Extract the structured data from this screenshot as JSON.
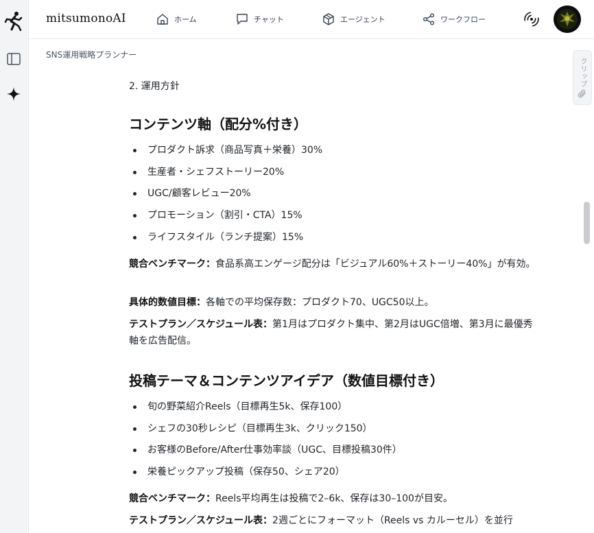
{
  "app": {
    "brand": "mitsumonoAI"
  },
  "nav": {
    "home": "ホーム",
    "chat": "チャット",
    "agent": "エージェント",
    "workflow": "ワークフロー"
  },
  "breadcrumb": "SNS運用戦略プランナー",
  "clip_tab": "クリップ",
  "content": {
    "section_label": "2. 運用方針",
    "section1": {
      "heading": "コンテンツ軸（配分%付き）",
      "items": [
        "プロダクト訴求（商品写真＋栄養）30%",
        "生産者・シェフストーリー20%",
        "UGC/顧客レビュー20%",
        "プロモーション（割引・CTA）15%",
        "ライフスタイル（ランチ提案）15%"
      ],
      "p1_label": "競合ベンチマーク：",
      "p1_text": "食品系高エンゲージ配分は「ビジュアル60%＋ストーリー40%」が有効。",
      "p2_label": "具体的数値目標：",
      "p2_text": "各軸での平均保存数：プロダクト70、UGC50以上。",
      "p3_label": "テストプラン／スケジュール表：",
      "p3_text": "第1月はプロダクト集中、第2月はUGC倍増、第3月に最優秀軸を広告配信。"
    },
    "section2": {
      "heading": "投稿テーマ＆コンテンツアイデア（数値目標付き）",
      "items": [
        "旬の野菜紹介Reels（目標再生5k、保存100）",
        "シェフの30秒レシピ（目標再生3k、クリック150）",
        "お客様のBefore/After仕事効率談（UGC、目標投稿30件）",
        "栄養ピックアップ投稿（保存50、シェア20）"
      ],
      "p1_label": "競合ベンチマーク：",
      "p1_text": "Reels平均再生は投稿で2–6k、保存は30–100が目安。",
      "p2_label": "テストプラン／スケジュール表：",
      "p2_text": "2週ごとにフォーマット（Reels vs カルーセル）を並行"
    }
  }
}
